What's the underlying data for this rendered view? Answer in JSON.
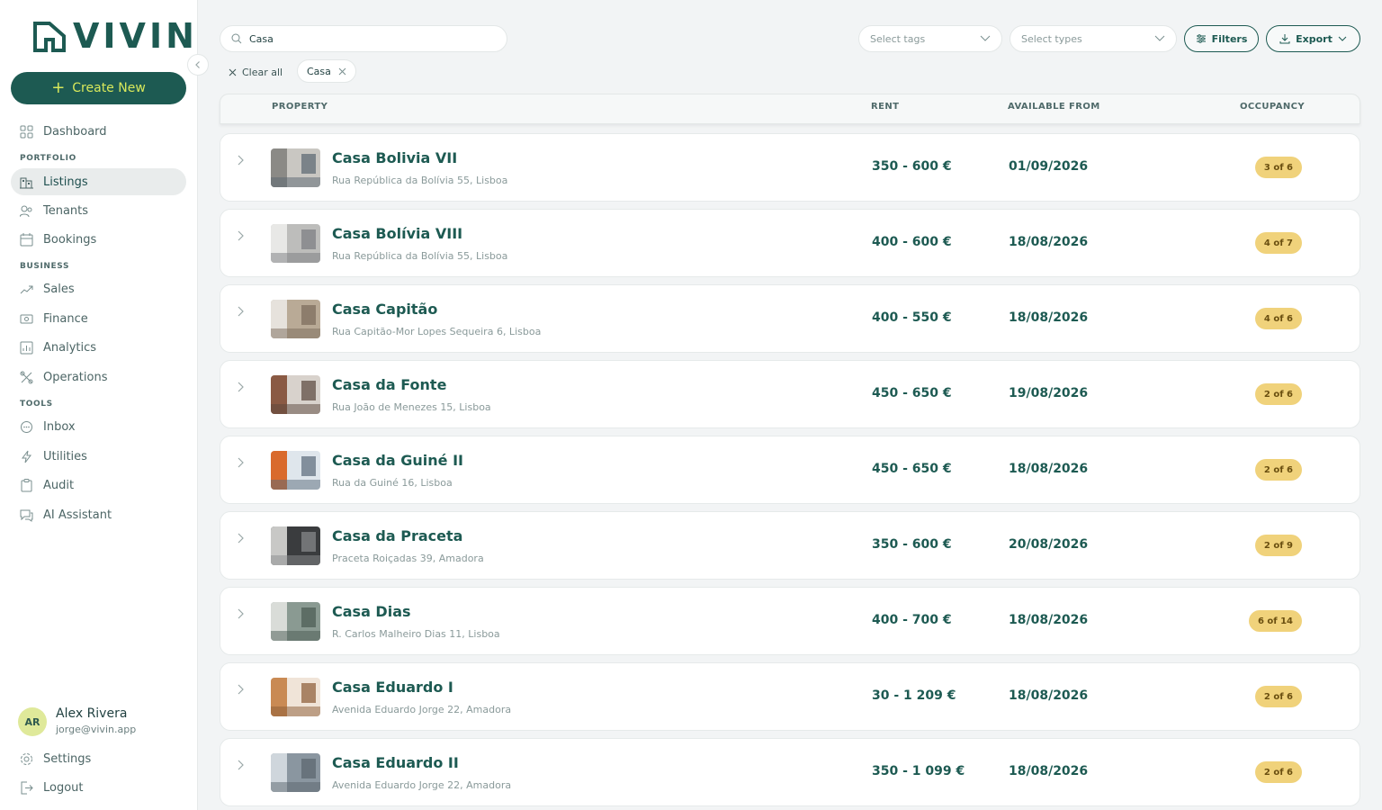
{
  "app": {
    "brand": "VIVIN",
    "create_label": "Create New"
  },
  "sidebar": {
    "items": [
      {
        "label": "Dashboard",
        "icon": "grid-icon"
      },
      {
        "section": "PORTFOLIO"
      },
      {
        "label": "Listings",
        "icon": "building-icon",
        "active": true
      },
      {
        "label": "Tenants",
        "icon": "users-icon"
      },
      {
        "label": "Bookings",
        "icon": "calendar-icon"
      },
      {
        "section": "BUSINESS"
      },
      {
        "label": "Sales",
        "icon": "trend-icon"
      },
      {
        "label": "Finance",
        "icon": "banknote-icon"
      },
      {
        "label": "Analytics",
        "icon": "bar-chart-icon"
      },
      {
        "label": "Operations",
        "icon": "tools-icon"
      },
      {
        "section": "TOOLS"
      },
      {
        "label": "Inbox",
        "icon": "chat-icon"
      },
      {
        "label": "Utilities",
        "icon": "bolt-icon"
      },
      {
        "label": "Audit",
        "icon": "clipboard-icon"
      },
      {
        "label": "AI Assistant",
        "icon": "ai-chat-icon"
      }
    ],
    "user": {
      "initials": "AR",
      "name": "Alex Rivera",
      "email": "jorge@vivin.app"
    },
    "settings_label": "Settings",
    "logout_label": "Logout"
  },
  "toolbar": {
    "search_value": "Casa",
    "tags_placeholder": "Select tags",
    "types_placeholder": "Select types",
    "filters_label": "Filters",
    "export_label": "Export",
    "clear_all_label": "Clear all",
    "active_chip": "Casa"
  },
  "table": {
    "columns": {
      "property": "PROPERTY",
      "rent": "RENT",
      "available": "AVAILABLE FROM",
      "occupancy": "OCCUPANCY"
    },
    "rows": [
      {
        "name": "Casa Bolivia VII",
        "address": "Rua República da Bolívia 55, Lisboa",
        "rent": "350 - 600 €",
        "available": "01/09/2026",
        "occupancy": "3 of 6"
      },
      {
        "name": "Casa Bolívia VIII",
        "address": "Rua República da Bolívia 55, Lisboa",
        "rent": "400 - 600 €",
        "available": "18/08/2026",
        "occupancy": "4 of 7"
      },
      {
        "name": "Casa Capitão",
        "address": "Rua Capitão-Mor Lopes Sequeira 6, Lisboa",
        "rent": "400 - 550 €",
        "available": "18/08/2026",
        "occupancy": "4 of 6"
      },
      {
        "name": "Casa da Fonte",
        "address": "Rua João de Menezes 15, Lisboa",
        "rent": "450 - 650 €",
        "available": "19/08/2026",
        "occupancy": "2 of 6"
      },
      {
        "name": "Casa da Guiné II",
        "address": "Rua da Guiné 16, Lisboa",
        "rent": "450 - 650 €",
        "available": "18/08/2026",
        "occupancy": "2 of 6"
      },
      {
        "name": "Casa da Praceta",
        "address": "Praceta Roiçadas 39, Amadora",
        "rent": "350 - 600 €",
        "available": "20/08/2026",
        "occupancy": "2 of 9"
      },
      {
        "name": "Casa Dias",
        "address": "R. Carlos Malheiro Dias 11, Lisboa",
        "rent": "400 - 700 €",
        "available": "18/08/2026",
        "occupancy": "6 of 14"
      },
      {
        "name": "Casa Eduardo I",
        "address": "Avenida Eduardo Jorge 22, Amadora",
        "rent": "30 - 1 209 €",
        "available": "18/08/2026",
        "occupancy": "2 of 6"
      },
      {
        "name": "Casa Eduardo II",
        "address": "Avenida Eduardo Jorge 22, Amadora",
        "rent": "350 - 1 099 €",
        "available": "18/08/2026",
        "occupancy": "2 of 6"
      }
    ]
  },
  "colors": {
    "brand": "#1d5a52",
    "accent": "#d8e85b",
    "badge": "#f0d27b"
  }
}
